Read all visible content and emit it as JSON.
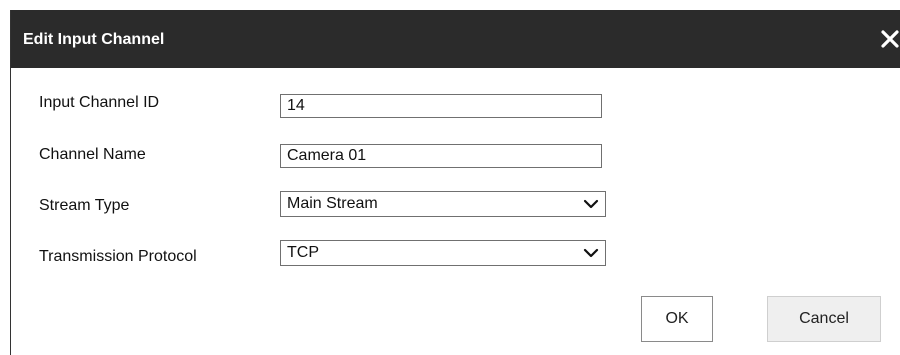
{
  "dialog": {
    "title": "Edit Input Channel",
    "close_icon": "close-icon"
  },
  "form": {
    "input_channel_id": {
      "label": "Input Channel ID",
      "value": "14"
    },
    "channel_name": {
      "label": "Channel Name",
      "value": "Camera 01"
    },
    "stream_type": {
      "label": "Stream Type",
      "value": "Main Stream"
    },
    "transmission_protocol": {
      "label": "Transmission Protocol",
      "value": "TCP"
    }
  },
  "buttons": {
    "ok": "OK",
    "cancel": "Cancel"
  },
  "colors": {
    "titlebar": "#2b2b2b",
    "title_text": "#ffffff"
  }
}
